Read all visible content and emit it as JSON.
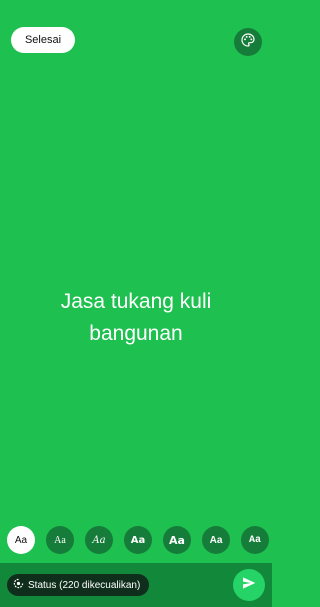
{
  "top_bar": {
    "done_label": "Selesai",
    "palette_icon": "palette-icon"
  },
  "status": {
    "text": "Jasa tukang kuli bangunan",
    "background_color": "#1ec04f"
  },
  "font_picker": {
    "options": [
      {
        "label": "Aa",
        "selected": true
      },
      {
        "label": "Aa",
        "selected": false
      },
      {
        "label": "Aa",
        "selected": false
      },
      {
        "label": "Aa",
        "selected": false
      },
      {
        "label": "Aa",
        "selected": false
      },
      {
        "label": "Aa",
        "selected": false
      },
      {
        "label": "Aa",
        "selected": false
      }
    ]
  },
  "bottom_bar": {
    "audience_label": "Status (220 dikecualikan)",
    "audience_icon": "status-ring-icon",
    "send_icon": "send-icon"
  }
}
